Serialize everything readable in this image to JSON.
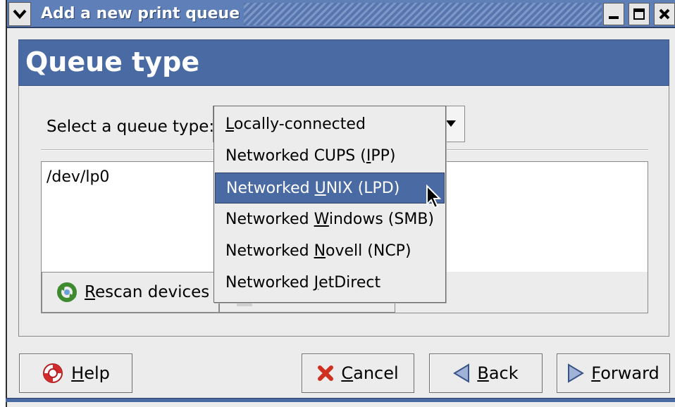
{
  "window": {
    "title": "Add a new print queue"
  },
  "header": {
    "title": "Queue type"
  },
  "form": {
    "select_label": "Select a queue type:"
  },
  "dropdown": {
    "selected_index": 2,
    "items": [
      {
        "pre": "",
        "mn": "L",
        "post": "ocally-connected"
      },
      {
        "pre": "Networked CUPS (",
        "mn": "I",
        "post": "PP)"
      },
      {
        "pre": "Networked ",
        "mn": "U",
        "post": "NIX (LPD)"
      },
      {
        "pre": "Networked ",
        "mn": "W",
        "post": "indows (SMB)"
      },
      {
        "pre": "Networked ",
        "mn": "N",
        "post": "ovell (NCP)"
      },
      {
        "pre": "Networked ",
        "mn": "J",
        "post": "etDirect"
      }
    ]
  },
  "devices": {
    "items": [
      "/dev/lp0"
    ],
    "rescan": {
      "mn": "R",
      "post": "escan devices",
      "icon": "refresh-icon"
    }
  },
  "buttons": {
    "help": {
      "mn": "H",
      "post": "elp",
      "icon": "lifebuoy-icon"
    },
    "cancel": {
      "mn": "C",
      "post": "ancel",
      "icon": "x-icon"
    },
    "back": {
      "mn": "B",
      "post": "ack",
      "icon": "left-arrow-icon"
    },
    "forward": {
      "mn": "F",
      "post": "orward",
      "icon": "right-arrow-icon"
    }
  },
  "colors": {
    "accent": "#4a6aa4",
    "titlebar": "#5e7fb8",
    "background": "#ececec"
  }
}
